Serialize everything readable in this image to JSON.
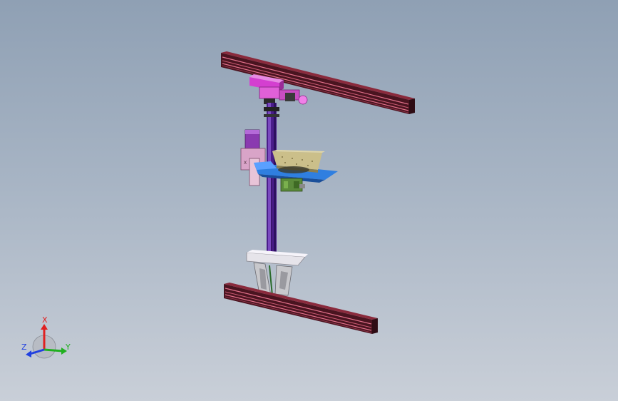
{
  "scene": {
    "title": "",
    "colors": {
      "background_top": "#8fa0b4",
      "background_bottom": "#c9cfd8",
      "rail_body": "#6a1c2a",
      "rail_highlight": "#d9607a",
      "carriage": "#d43fd0",
      "column": "#4a1d8a",
      "platform_blue": "#2f7fe0",
      "plate_tan": "#cbbf8a",
      "motor_green": "#5a8a3a",
      "bracket_gray": "#c8c8cc",
      "base_plate": "#e6e4ea"
    }
  },
  "triad": {
    "x_label": "X",
    "y_label": "Y",
    "z_label": "Z",
    "x_color": "#e02020",
    "y_color": "#20b020",
    "z_color": "#2040e0"
  }
}
